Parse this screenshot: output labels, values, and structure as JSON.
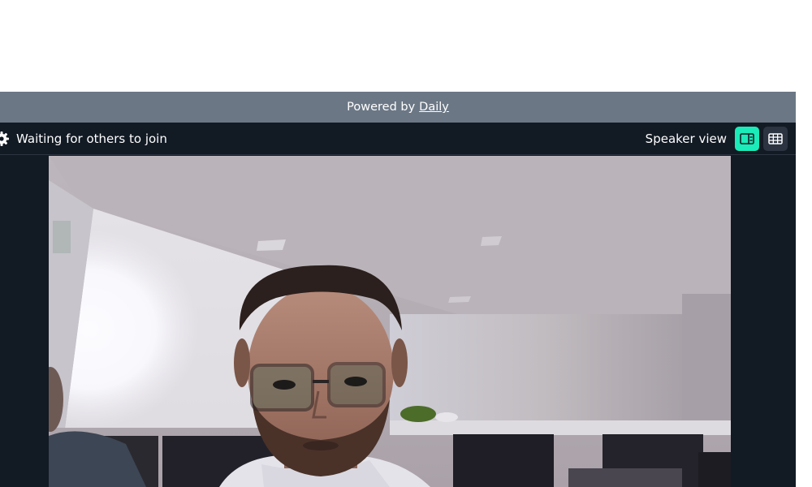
{
  "powered": {
    "prefix": "Powered by",
    "link_label": "Daily"
  },
  "topbar": {
    "status_text": "Waiting for others to join",
    "view_label": "Speaker view",
    "active_view": "speaker"
  },
  "icons": {
    "settings": "gear-icon",
    "speaker_view": "speaker-view-icon",
    "grid_view": "grid-view-icon"
  },
  "colors": {
    "call_background": "#121a24",
    "banner_background": "#6b7785",
    "active_accent": "#1bebb9",
    "inactive_button": "#2b3440"
  }
}
